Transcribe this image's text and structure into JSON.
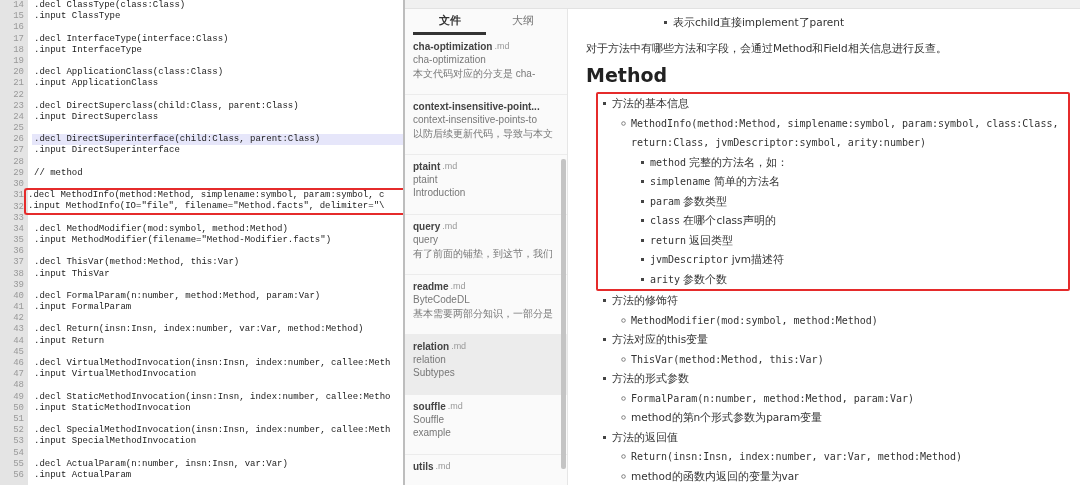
{
  "editor": {
    "lines": [
      {
        "number": "14",
        "text": ".decl ClassType(class:Class)",
        "highlighted": false,
        "boxed": false
      },
      {
        "number": "15",
        "text": ".input ClassType",
        "highlighted": false,
        "boxed": false
      },
      {
        "number": "16",
        "highlighted": false,
        "boxed": false
      },
      {
        "number": "17",
        "text": ".decl InterfaceType(interface:Class)",
        "highlighted": false,
        "boxed": false
      },
      {
        "number": "18",
        "text": ".input InterfaceType",
        "highlighted": false,
        "boxed": false
      },
      {
        "number": "19",
        "highlighted": false,
        "boxed": false
      },
      {
        "number": "20",
        "text": ".decl ApplicationClass(class:Class)",
        "highlighted": false,
        "boxed": false
      },
      {
        "number": "21",
        "text": ".input ApplicationClass",
        "highlighted": false,
        "boxed": false
      },
      {
        "number": "22",
        "highlighted": false,
        "boxed": false
      },
      {
        "number": "23",
        "text": ".decl DirectSuperclass(child:Class, parent:Class)",
        "highlighted": false,
        "boxed": false
      },
      {
        "number": "24",
        "text": ".input DirectSuperclass",
        "highlighted": false,
        "boxed": false
      },
      {
        "number": "25",
        "highlighted": false,
        "boxed": false
      },
      {
        "number": "26",
        "text": ".decl DirectSuperinterface(child:Class, parent:Class)",
        "highlighted": true,
        "boxed": false
      },
      {
        "number": "27",
        "text": ".input DirectSuperinterface",
        "highlighted": false,
        "boxed": false
      },
      {
        "number": "28",
        "highlighted": false,
        "boxed": false
      },
      {
        "number": "29",
        "text": "// method",
        "highlighted": false,
        "boxed": false
      },
      {
        "number": "30",
        "highlighted": false,
        "boxed": false
      },
      {
        "number": "31",
        "text": ".decl MethodInfo(method:Method, simplename:symbol, param:symbol, c",
        "highlighted": false,
        "boxed": true
      },
      {
        "number": "32",
        "text": ".input MethodInfo(IO=\"file\", filename=\"Method.facts\", delimiter=\"\\",
        "highlighted": false,
        "boxed": true
      },
      {
        "number": "33",
        "highlighted": false,
        "boxed": false
      },
      {
        "number": "34",
        "text": ".decl MethodModifier(mod:symbol, method:Method)",
        "highlighted": false,
        "boxed": false
      },
      {
        "number": "35",
        "text": ".input MethodModifier(filename=\"Method-Modifier.facts\")",
        "highlighted": false,
        "boxed": false
      },
      {
        "number": "36",
        "highlighted": false,
        "boxed": false
      },
      {
        "number": "37",
        "text": ".decl ThisVar(method:Method, this:Var)",
        "highlighted": false,
        "boxed": false
      },
      {
        "number": "38",
        "text": ".input ThisVar",
        "highlighted": false,
        "boxed": false
      },
      {
        "number": "39",
        "highlighted": false,
        "boxed": false
      },
      {
        "number": "40",
        "text": ".decl FormalParam(n:number, method:Method, param:Var)",
        "highlighted": false,
        "boxed": false
      },
      {
        "number": "41",
        "text": ".input FormalParam",
        "highlighted": false,
        "boxed": false
      },
      {
        "number": "42",
        "highlighted": false,
        "boxed": false
      },
      {
        "number": "43",
        "text": ".decl Return(insn:Insn, index:number, var:Var, method:Method)",
        "highlighted": false,
        "boxed": false
      },
      {
        "number": "44",
        "text": ".input Return",
        "highlighted": false,
        "boxed": false
      },
      {
        "number": "45",
        "highlighted": false,
        "boxed": false
      },
      {
        "number": "46",
        "text": ".decl VirtualMethodInvocation(insn:Insn, index:number, callee:Meth",
        "highlighted": false,
        "boxed": false
      },
      {
        "number": "47",
        "text": ".input VirtualMethodInvocation",
        "highlighted": false,
        "boxed": false
      },
      {
        "number": "48",
        "highlighted": false,
        "boxed": false
      },
      {
        "number": "49",
        "text": ".decl StaticMethodInvocation(insn:Insn, index:number, callee:Metho",
        "highlighted": false,
        "boxed": false
      },
      {
        "number": "50",
        "text": ".input StaticMethodInvocation",
        "highlighted": false,
        "boxed": false
      },
      {
        "number": "51",
        "highlighted": false,
        "boxed": false
      },
      {
        "number": "52",
        "text": ".decl SpecialMethodInvocation(insn:Insn, index:number, callee:Meth",
        "highlighted": false,
        "boxed": false
      },
      {
        "number": "53",
        "text": ".input SpecialMethodInvocation",
        "highlighted": false,
        "boxed": false
      },
      {
        "number": "54",
        "highlighted": false,
        "boxed": false
      },
      {
        "number": "55",
        "text": ".decl ActualParam(n:number, insn:Insn, var:Var)",
        "highlighted": false,
        "boxed": false
      },
      {
        "number": "56",
        "text": ".input ActualParam",
        "highlighted": false,
        "boxed": false
      }
    ]
  },
  "sidebar": {
    "tabs": [
      {
        "label": "文件",
        "selected": true
      },
      {
        "label": "大纲",
        "selected": false
      }
    ],
    "files": [
      {
        "name": "cha-optimization",
        "ext": ".md",
        "title": "cha-optimization",
        "excerpt": "本文代码对应的分支是 cha-",
        "selected": false
      },
      {
        "name": "context-insensitive-point...",
        "title": "context-insensitive-points-to",
        "excerpt": "以防后续更新代码，导致与本文",
        "selected": false
      },
      {
        "name": "ptaint",
        "ext": ".md",
        "title": "ptaint",
        "excerpt": "Introduction",
        "selected": false
      },
      {
        "name": "query",
        "ext": ".md",
        "title": "query",
        "excerpt": "有了前面的铺垫，到这节，我们",
        "selected": false
      },
      {
        "name": "readme",
        "ext": ".md",
        "title": "ByteCodeDL",
        "excerpt": "基本需要两部分知识，一部分是",
        "selected": false
      },
      {
        "name": "relation",
        "ext": ".md",
        "title": "relation",
        "excerpt": "Subtypes",
        "selected": true
      },
      {
        "name": "souffle",
        "ext": ".md",
        "title": "Souffle",
        "excerpt": "example",
        "selected": false
      },
      {
        "name": "utils",
        "ext": ".md",
        "selected": false
      }
    ]
  },
  "preview": {
    "blocks": [
      {
        "kind": "sublist",
        "items": [
          {
            "text": "表示child直接implement了parent"
          }
        ]
      },
      {
        "kind": "paragraph",
        "text": "对于方法中有哪些方法和字段，会通过Method和Field相关信息进行反查。"
      },
      {
        "kind": "heading",
        "text": "Method"
      },
      {
        "kind": "list",
        "items": [
          {
            "text": "方法的基本信息",
            "boxed": true,
            "children": [
              {
                "code": "MethodInfo(method:Method, simplename:symbol, param:symbol, class:Class, return:Class, jvmDescriptor:symbol, arity:number)",
                "children": [
                  {
                    "code": "method",
                    "text": "完整的方法名，如："
                  },
                  {
                    "code": "simplename",
                    "text": "简单的方法名"
                  },
                  {
                    "code": "param",
                    "text": "参数类型"
                  },
                  {
                    "code": "class",
                    "text": "在哪个class声明的"
                  },
                  {
                    "code": "return",
                    "text": "返回类型"
                  },
                  {
                    "code": "jvmDescriptor",
                    "text": "jvm描述符"
                  },
                  {
                    "code": "arity",
                    "text": "参数个数"
                  }
                ]
              }
            ]
          },
          {
            "text": "方法的修饰符",
            "boxed": false,
            "children": [
              {
                "code": "MethodModifier(mod:symbol, method:Method)"
              }
            ]
          },
          {
            "text": "方法对应的this变量",
            "boxed": false,
            "children": [
              {
                "code": "ThisVar(method:Method, this:Var)"
              }
            ]
          },
          {
            "text": "方法的形式参数",
            "boxed": false,
            "children": [
              {
                "code": "FormalParam(n:number, method:Method, param:Var)"
              },
              {
                "text": "method的第n个形式参数为param变量"
              }
            ]
          },
          {
            "text": "方法的返回值",
            "boxed": false,
            "children": [
              {
                "code": "Return(insn:Insn, index:number, var:Var, method:Method)"
              },
              {
                "text": "method的函数内返回的变量为var"
              }
            ]
          }
        ]
      }
    ]
  }
}
